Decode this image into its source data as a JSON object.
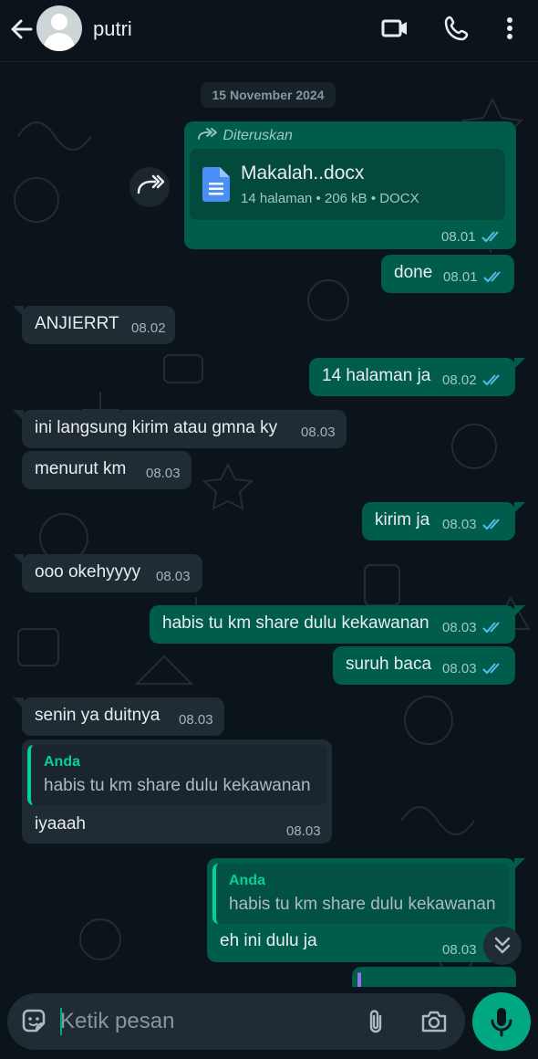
{
  "header": {
    "contact_name": "putri",
    "icons": [
      "back-arrow-icon",
      "avatar",
      "video-call-icon",
      "voice-call-icon",
      "more-options-icon"
    ]
  },
  "chat": {
    "date_chip": "15 November 2024",
    "forwarded_label": "Diteruskan",
    "document": {
      "name": "Makalah..docx",
      "meta": "14 halaman • 206 kB • DOCX",
      "time": "08.01"
    },
    "messages": [
      {
        "dir": "out",
        "text": "done",
        "time": "08.01"
      },
      {
        "dir": "in",
        "text": "ANJIERRT",
        "time": "08.02"
      },
      {
        "dir": "out",
        "text": "14 halaman ja",
        "time": "08.02"
      },
      {
        "dir": "in",
        "text": "ini langsung kirim atau gmna ky",
        "time": "08.03"
      },
      {
        "dir": "in",
        "text": "menurut km",
        "time": "08.03"
      },
      {
        "dir": "out",
        "text": "kirim ja",
        "time": "08.03"
      },
      {
        "dir": "in",
        "text": "ooo okehyyyy",
        "time": "08.03"
      },
      {
        "dir": "out",
        "text": "habis tu km share dulu kekawanan",
        "time": "08.03"
      },
      {
        "dir": "out",
        "text": "suruh baca",
        "time": "08.03"
      },
      {
        "dir": "in",
        "text": "senin ya duitnya",
        "time": "08.03"
      },
      {
        "dir": "in",
        "quote_author": "Anda",
        "quote_text": "habis tu km share dulu kekawanan",
        "text": "iyaaah",
        "time": "08.03"
      },
      {
        "dir": "out",
        "quote_author": "Anda",
        "quote_text": "habis tu km share dulu kekawanan",
        "text": "eh ini dulu ja",
        "time": "08.03"
      }
    ]
  },
  "input": {
    "placeholder": "Ketik pesan",
    "value": ""
  },
  "colors": {
    "background": "#0b141a",
    "incoming_bubble": "#1f2c34",
    "outgoing_bubble": "#005c4b",
    "accent": "#00a884",
    "read_tick": "#53bdeb"
  }
}
